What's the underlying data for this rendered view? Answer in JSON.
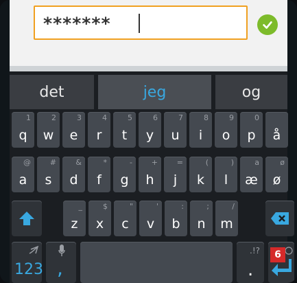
{
  "password_field": {
    "value": "*******"
  },
  "suggestions": [
    "det",
    "jeg",
    "og"
  ],
  "rows": [
    [
      {
        "label": "q",
        "hint": "1"
      },
      {
        "label": "w",
        "hint": "2"
      },
      {
        "label": "e",
        "hint": "3"
      },
      {
        "label": "r",
        "hint": "4"
      },
      {
        "label": "t",
        "hint": "5"
      },
      {
        "label": "y",
        "hint": "6"
      },
      {
        "label": "u",
        "hint": "7"
      },
      {
        "label": "i",
        "hint": "8"
      },
      {
        "label": "o",
        "hint": "9"
      },
      {
        "label": "p",
        "hint": "0"
      },
      {
        "label": "å",
        "hint": ""
      }
    ],
    [
      {
        "label": "a",
        "hint": "@"
      },
      {
        "label": "s",
        "hint": "#"
      },
      {
        "label": "d",
        "hint": "&"
      },
      {
        "label": "f",
        "hint": "*"
      },
      {
        "label": "g",
        "hint": "-"
      },
      {
        "label": "h",
        "hint": "+"
      },
      {
        "label": "j",
        "hint": "="
      },
      {
        "label": "k",
        "hint": "("
      },
      {
        "label": "l",
        "hint": ")"
      },
      {
        "label": "æ",
        "hint": "a"
      },
      {
        "label": "ø",
        "hint": "ø"
      }
    ],
    [
      {
        "label": "z",
        "hint": "_"
      },
      {
        "label": "x",
        "hint": "$"
      },
      {
        "label": "c",
        "hint": "\""
      },
      {
        "label": "v",
        "hint": "'"
      },
      {
        "label": "b",
        "hint": ":"
      },
      {
        "label": "n",
        "hint": ";"
      },
      {
        "label": "m",
        "hint": "/"
      }
    ]
  ],
  "bottom": {
    "symbols_label": "123",
    "comma_label": ",",
    "punct_hint": ".!?",
    "period_label": "."
  },
  "badge_label": "6",
  "colors": {
    "accent": "#39a8e0",
    "field_border": "#f0a020",
    "ok": "#7dbb2b",
    "badge": "#d52a2a"
  }
}
